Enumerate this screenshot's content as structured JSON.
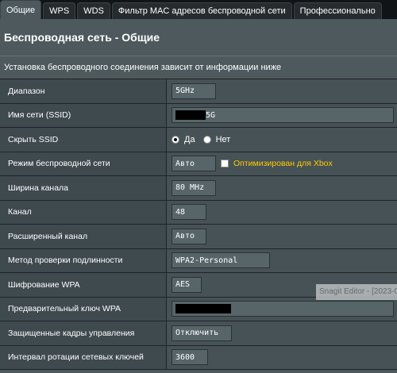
{
  "tabs": [
    "Общие",
    "WPS",
    "WDS",
    "Фильтр MAC адресов беспроводной сети",
    "Профессионально"
  ],
  "active_tab": "Общие",
  "title": "Беспроводная сеть - Общие",
  "intro": "Установка беспроводного соединения зависит от информации ниже",
  "rows": {
    "band": {
      "label": "Диапазон",
      "value": "5GHz"
    },
    "ssid": {
      "label": "Имя сети (SSID)",
      "value_suffix": "5G"
    },
    "hide_ssid": {
      "label": "Скрыть SSID",
      "yes": "Да",
      "no": "Нет",
      "selected": "Да"
    },
    "mode": {
      "label": "Режим беспроводной сети",
      "value": "Авто",
      "xbox_label": "Оптимизирован для Xbox",
      "xbox_checked": false
    },
    "width": {
      "label": "Ширина канала",
      "value": "80 MHz"
    },
    "channel": {
      "label": "Канал",
      "value": "48"
    },
    "ext_channel": {
      "label": "Расширенный канал",
      "value": "Авто"
    },
    "auth": {
      "label": "Метод проверки подлинности",
      "value": "WPA2-Personal"
    },
    "wpa_enc": {
      "label": "Шифрование WPA",
      "value": "AES"
    },
    "wpa_key": {
      "label": "Предварительный ключ WPA"
    },
    "pmf": {
      "label": "Защищенные кадры управления",
      "value": "Отключить"
    },
    "rotation": {
      "label": "Интервал ротации сетевых ключей",
      "value": "3600"
    }
  },
  "overlay": {
    "snagit_text": "Snagit Editor - [2023-0"
  }
}
